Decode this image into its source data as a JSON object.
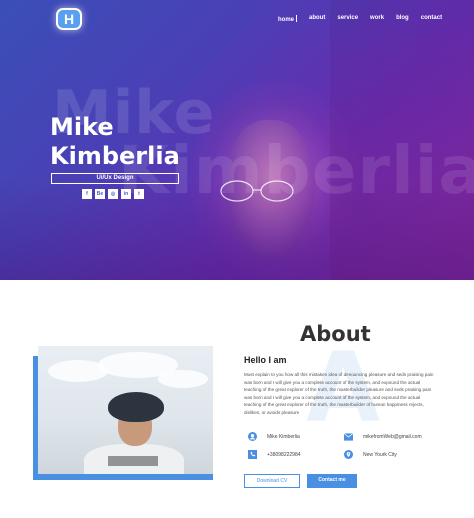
{
  "hero": {
    "logo_letter": "H",
    "nav": [
      "home",
      "about",
      "service",
      "work",
      "blog",
      "contact"
    ],
    "name_line1": "Mike",
    "name_line2": "Kimberlia",
    "bg_text_line1": "Mike",
    "bg_text_line2": "Kimberlia",
    "role": "Ui/Ux Design",
    "socials": [
      "f",
      "Be",
      "◎",
      "in",
      "t"
    ]
  },
  "about": {
    "title": "About",
    "watermark_letter": "A",
    "greeting": "Hello I am",
    "description": "Must explain to you how all this mistaken idea of denouncing pleasure and seds praising pain was born and I will give you a complete account of the system, and expound the actual teaching of the great explorer of the truth, the masterbuilder pleasure and seds praising pain was born and I will give you a complete account of the system, and expound the actual teaching of the great explorer of the truth, the masterbuilder of human happiness rejects, dislikes, or avoids pleasure",
    "info": {
      "name": "Mike Kimberlia",
      "email": "mikefromWeb@gmail.com",
      "phone": "+38098222984",
      "location": "New Yourk City"
    },
    "download_label": "Download CV",
    "contact_label": "Contact me"
  },
  "colors": {
    "accent": "#4a90e2",
    "hero_start": "#3a4fb8",
    "hero_end": "#8a2aa6"
  }
}
